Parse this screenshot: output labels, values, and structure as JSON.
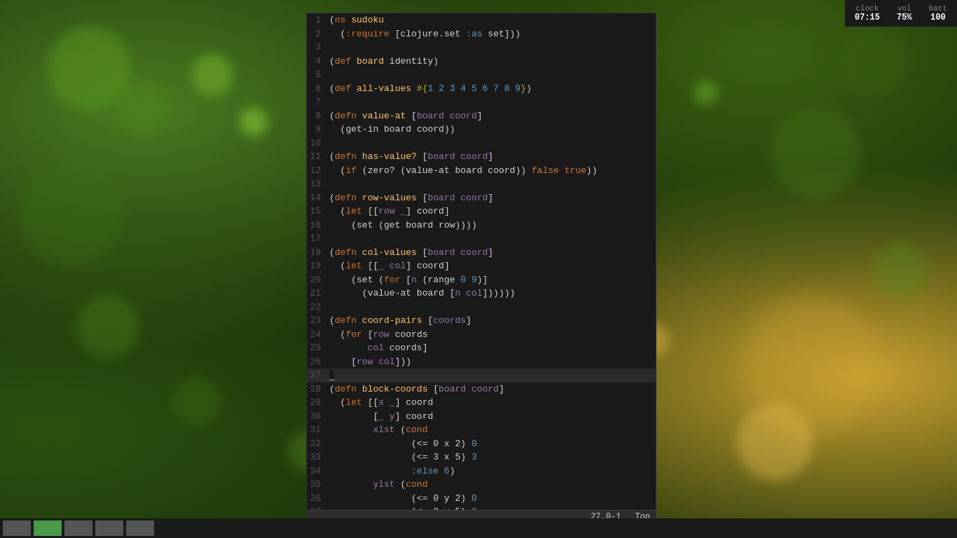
{
  "background": {
    "color": "#1a3008"
  },
  "system_bar": {
    "clock_label": "clock",
    "clock_value": "07:15",
    "vol_label": "vol",
    "vol_value": "75%",
    "batt_label": "batt",
    "batt_value": "100"
  },
  "editor": {
    "status_position": "27,0-1",
    "status_top": "Top"
  },
  "taskbar": {
    "buttons": [
      {
        "label": "",
        "active": true
      },
      {
        "label": "",
        "active": true
      },
      {
        "label": "",
        "active": false
      },
      {
        "label": "",
        "active": false
      },
      {
        "label": "",
        "active": false
      }
    ]
  }
}
